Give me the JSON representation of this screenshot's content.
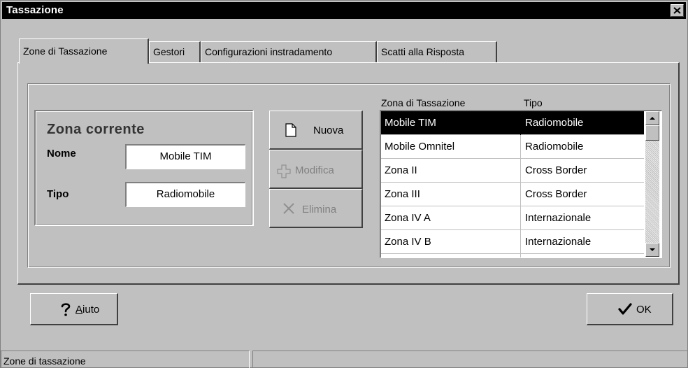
{
  "window": {
    "title": "Tassazione"
  },
  "tabs": [
    {
      "label": "Zone di Tassazione"
    },
    {
      "label": "Gestori"
    },
    {
      "label": "Configurazioni instradamento"
    },
    {
      "label": "Scatti alla Risposta"
    }
  ],
  "current_zone": {
    "title": "Zona corrente",
    "name_label": "Nome",
    "name_value": "Mobile TIM",
    "type_label": "Tipo",
    "type_value": "Radiomobile"
  },
  "actions": {
    "new_label": "Nuova",
    "edit_label": "Modifica",
    "delete_label": "Elimina"
  },
  "zone_list": {
    "columns": [
      "Zona di Tassazione",
      "Tipo"
    ],
    "rows": [
      {
        "zone": "Mobile TIM",
        "type": "Radiomobile"
      },
      {
        "zone": "Mobile Omnitel",
        "type": "Radiomobile"
      },
      {
        "zone": "Zona II",
        "type": "Cross Border"
      },
      {
        "zone": "Zona III",
        "type": "Cross Border"
      },
      {
        "zone": "Zona IV A",
        "type": "Internazionale"
      },
      {
        "zone": "Zona IV B",
        "type": "Internazionale"
      }
    ]
  },
  "footer": {
    "help_mnemonic": "A",
    "help_rest": "iuto",
    "ok_label": "OK"
  },
  "status": {
    "text": "Zone di tassazione"
  },
  "icons": {
    "close": "close-icon",
    "new": "new-document-icon",
    "edit": "cross-edit-icon",
    "delete": "x-delete-icon",
    "help": "question-mark-icon",
    "ok": "checkmark-icon"
  },
  "colors": {
    "titlebar": "#000000",
    "face": "#c0c0c0",
    "selection": "#000000"
  }
}
